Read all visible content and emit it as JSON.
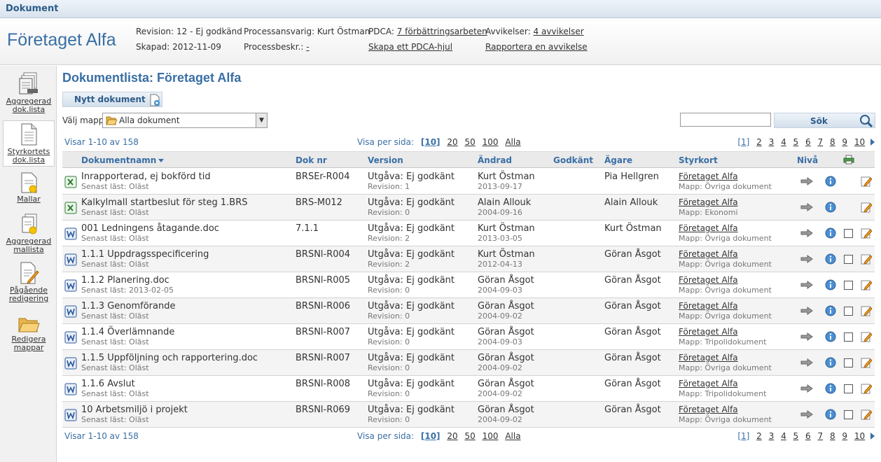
{
  "window": {
    "title": "Dokument"
  },
  "header": {
    "company": "Företaget Alfa",
    "revision": "Revision: 12 - Ej godkänd",
    "created": "Skapad: 2012-11-09",
    "process_owner": "Processansvarig: Kurt Östman",
    "process_desc_label": "Processbeskr.:",
    "process_desc_link": "-",
    "pdca_label": "PDCA:",
    "pdca_link": "7 förbättringsarbeten",
    "pdca_create": "Skapa ett PDCA-hjul",
    "deviations_label": "Avvikelser:",
    "deviations_link": "4 avvikelser",
    "report_deviation": "Rapportera en avvikelse"
  },
  "sidebar": {
    "items": [
      {
        "label1": "Aggregerad",
        "label2": "dok.lista",
        "icon": "stacked-documents-icon"
      },
      {
        "label1": "Styrkortets",
        "label2": "dok.lista",
        "icon": "document-icon"
      },
      {
        "label1": "Mallar",
        "label2": "",
        "icon": "template-icon"
      },
      {
        "label1": "Aggregerad",
        "label2": "mallista",
        "icon": "stacked-templates-icon"
      },
      {
        "label1": "Pågående",
        "label2": "redigering",
        "icon": "edit-document-icon"
      },
      {
        "label1": "Redigera",
        "label2": "mappar",
        "icon": "folder-icon"
      }
    ]
  },
  "main": {
    "title": "Dokumentlista: Företaget Alfa",
    "new_document": "Nytt dokument",
    "folder_label": "Välj mapp",
    "folder_value": "Alla dokument",
    "search_value": "",
    "search_button": "Sök",
    "showing": "Visar 1-10 av 158",
    "per_page_label": "Visa per sida:",
    "per_page_options": [
      "[10]",
      "20",
      "50",
      "100",
      "Alla"
    ],
    "pages": [
      "[1]",
      "2",
      "3",
      "4",
      "5",
      "6",
      "7",
      "8",
      "9",
      "10"
    ]
  },
  "table": {
    "columns": {
      "name": "Dokumentnamn",
      "docno": "Dok nr",
      "version": "Version",
      "changed": "Ändrad",
      "approved": "Godkänt",
      "owner": "Ägare",
      "scorecard": "Styrkort",
      "level": "Nivå"
    },
    "rows": [
      {
        "type": "excel",
        "name": "Inrapporterad, ej bokförd tid",
        "last_read": "Senast läst: Oläst",
        "docno": "BRSEr-R004",
        "version": "Utgåva: Ej godkänt",
        "revision": "Revision: 1",
        "changed_by": "Kurt Östman",
        "changed_date": "2013-09-17",
        "owner": "Pia Hellgren",
        "scorecard": "Företaget Alfa",
        "folder": "Mapp: Övriga dokument",
        "checkbox": false
      },
      {
        "type": "excel",
        "name": "Kalkylmall startbeslut för steg 1.BRS",
        "last_read": "Senast läst: Oläst",
        "docno": "BRS-M012",
        "version": "Utgåva: Ej godkänt",
        "revision": "Revision: 0",
        "changed_by": "Alain Allouk",
        "changed_date": "2004-09-16",
        "owner": "Alain Allouk",
        "scorecard": "Företaget Alfa",
        "folder": "Mapp: Ekonomi",
        "checkbox": false
      },
      {
        "type": "word",
        "name": "001 Ledningens åtagande.doc",
        "last_read": "Senast läst: Oläst",
        "docno": "7.1.1",
        "version": "Utgåva: Ej godkänt",
        "revision": "Revision: 2",
        "changed_by": "Kurt Östman",
        "changed_date": "2013-03-05",
        "owner": "Kurt Östman",
        "scorecard": "Företaget Alfa",
        "folder": "Mapp: Övriga dokument",
        "checkbox": true
      },
      {
        "type": "word",
        "name": "1.1.1 Uppdragsspecificering",
        "last_read": "Senast läst: Oläst",
        "docno": "BRSNl-R004",
        "version": "Utgåva: Ej godkänt",
        "revision": "Revision: 2",
        "changed_by": "Kurt Östman",
        "changed_date": "2012-04-13",
        "owner": "Göran Åsgot",
        "scorecard": "Företaget Alfa",
        "folder": "Mapp: Övriga dokument",
        "checkbox": true
      },
      {
        "type": "word",
        "name": "1.1.2 Planering.doc",
        "last_read": "Senast läst: 2013-02-05",
        "docno": "BRSNl-R005",
        "version": "Utgåva: Ej godkänt",
        "revision": "Revision: 0",
        "changed_by": "Göran Åsgot",
        "changed_date": "2004-09-03",
        "owner": "Göran Åsgot",
        "scorecard": "Företaget Alfa",
        "folder": "Mapp: Övriga dokument",
        "checkbox": true
      },
      {
        "type": "word",
        "name": "1.1.3 Genomförande",
        "last_read": "Senast läst: Oläst",
        "docno": "BRSNl-R006",
        "version": "Utgåva: Ej godkänt",
        "revision": "Revision: 0",
        "changed_by": "Göran Åsgot",
        "changed_date": "2004-09-02",
        "owner": "Göran Åsgot",
        "scorecard": "Företaget Alfa",
        "folder": "Mapp: Övriga dokument",
        "checkbox": true
      },
      {
        "type": "word",
        "name": "1.1.4 Överlämnande",
        "last_read": "Senast läst: Oläst",
        "docno": "BRSNl-R007",
        "version": "Utgåva: Ej godkänt",
        "revision": "Revision: 0",
        "changed_by": "Göran Åsgot",
        "changed_date": "2004-09-03",
        "owner": "Göran Åsgot",
        "scorecard": "Företaget Alfa",
        "folder": "Mapp: Tripolidokument",
        "checkbox": true
      },
      {
        "type": "word",
        "name": "1.1.5 Uppföljning och rapportering.doc",
        "last_read": "Senast läst: Oläst",
        "docno": "BRSNl-R007",
        "version": "Utgåva: Ej godkänt",
        "revision": "Revision: 0",
        "changed_by": "Göran Åsgot",
        "changed_date": "2004-09-02",
        "owner": "Göran Åsgot",
        "scorecard": "Företaget Alfa",
        "folder": "Mapp: Övriga dokument",
        "checkbox": true
      },
      {
        "type": "word",
        "name": "1.1.6 Avslut",
        "last_read": "Senast läst: Oläst",
        "docno": "BRSNl-R008",
        "version": "Utgåva: Ej godkänt",
        "revision": "Revision: 0",
        "changed_by": "Göran Åsgot",
        "changed_date": "2004-09-02",
        "owner": "Göran Åsgot",
        "scorecard": "Företaget Alfa",
        "folder": "Mapp: Tripolidokument",
        "checkbox": true
      },
      {
        "type": "word",
        "name": "10 Arbetsmiljö i projekt",
        "last_read": "Senast läst: Oläst",
        "docno": "BRSNl-R069",
        "version": "Utgåva: Ej godkänt",
        "revision": "Revision: 0",
        "changed_by": "Göran Åsgot",
        "changed_date": "2004-09-02",
        "owner": "Göran Åsgot",
        "scorecard": "Företaget Alfa",
        "folder": "Mapp: Övriga dokument",
        "checkbox": true
      }
    ]
  },
  "colors": {
    "accent": "#3a6fa5",
    "header_bg": "#eaeaea",
    "row_alt": "#f4f4f4"
  }
}
